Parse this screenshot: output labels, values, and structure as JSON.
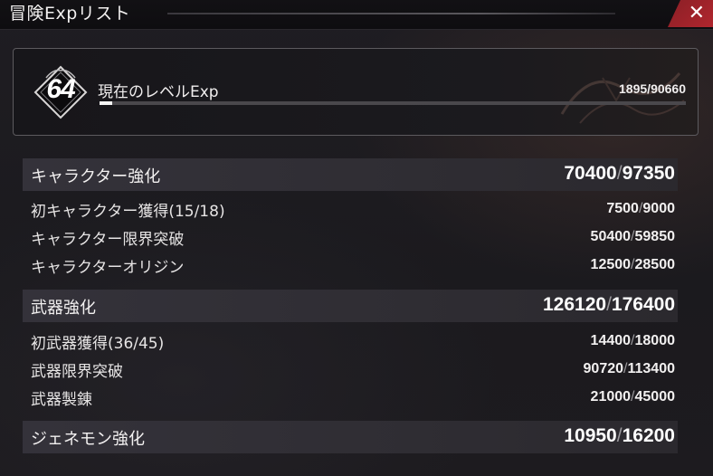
{
  "window": {
    "title": "冒険Expリスト",
    "close_label": "✕"
  },
  "level": {
    "number": "64",
    "label": "現在のレベルExp",
    "current": "1895",
    "max": "90660",
    "progress_fraction": 0.021
  },
  "sections": [
    {
      "label": "キャラクター強化",
      "current": "70400",
      "max": "97350",
      "rows": [
        {
          "label": "初キャラクター獲得(15/18)",
          "current": "7500",
          "max": "9000"
        },
        {
          "label": "キャラクター限界突破",
          "current": "50400",
          "max": "59850"
        },
        {
          "label": "キャラクターオリジン",
          "current": "12500",
          "max": "28500"
        }
      ]
    },
    {
      "label": "武器強化",
      "current": "126120",
      "max": "176400",
      "rows": [
        {
          "label": "初武器獲得(36/45)",
          "current": "14400",
          "max": "18000"
        },
        {
          "label": "武器限界突破",
          "current": "90720",
          "max": "113400"
        },
        {
          "label": "武器製錬",
          "current": "21000",
          "max": "45000"
        }
      ]
    },
    {
      "label": "ジェネモン強化",
      "current": "10950",
      "max": "16200",
      "rows": []
    }
  ],
  "separator": "/"
}
